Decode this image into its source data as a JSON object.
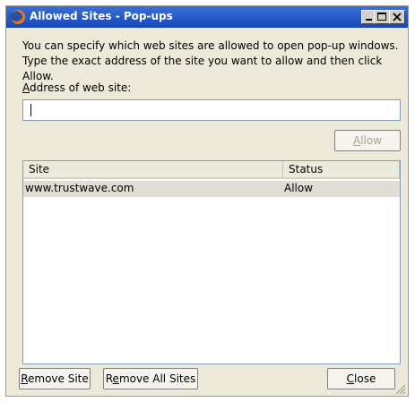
{
  "window": {
    "title": "Allowed Sites - Pop-ups",
    "icon": "firefox-icon",
    "controls": [
      "minimize-icon",
      "maximize-icon",
      "close-icon"
    ]
  },
  "description": "You can specify which web sites are allowed to open pop-up windows. Type the exact address of the site you want to allow and then click Allow.",
  "address": {
    "label_mnemonic": "A",
    "label_rest": "ddress of web site:",
    "value": ""
  },
  "buttons": {
    "allow_mnemonic": "A",
    "allow_rest": "llow",
    "remove_site_mnemonic": "R",
    "remove_site_rest": "emove Site",
    "remove_all_pre": "R",
    "remove_all_mnemonic": "e",
    "remove_all_rest": "move All Sites",
    "close_mnemonic": "C",
    "close_rest": "lose"
  },
  "table": {
    "columns": [
      "Site",
      "Status"
    ],
    "rows": [
      {
        "site": "www.trustwave.com",
        "status": "Allow"
      }
    ]
  },
  "colors": {
    "titlebar": "#1547b7",
    "dialog_bg": "#ece9d8",
    "selected_row": "#e0ddd3"
  }
}
